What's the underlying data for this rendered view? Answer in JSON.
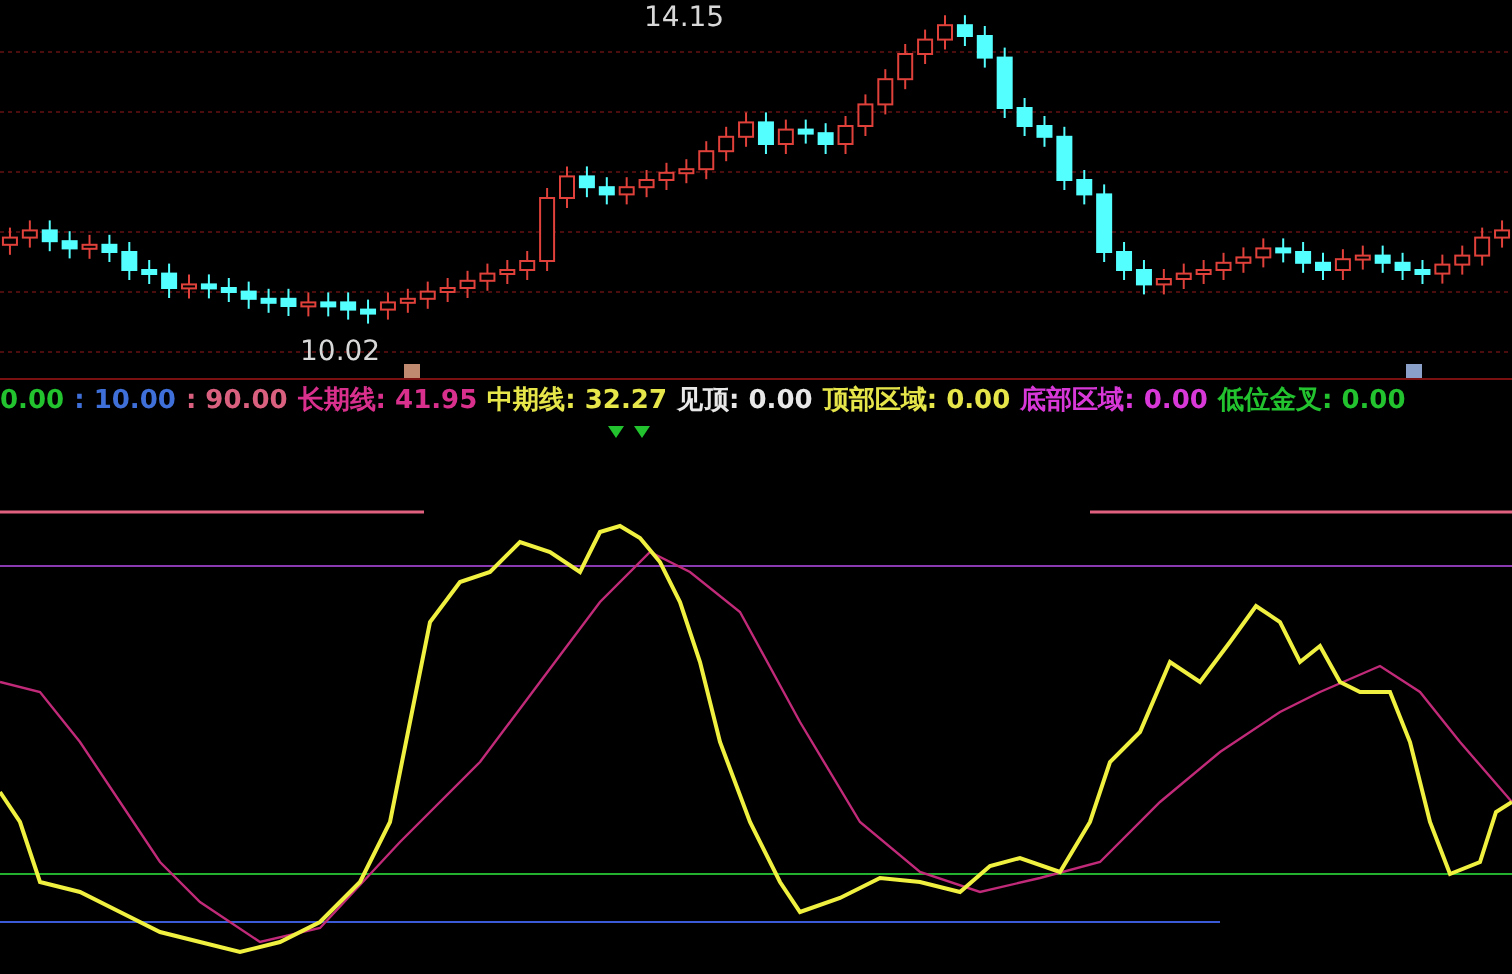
{
  "price_chart": {
    "high_label": "14.15",
    "low_label": "10.02"
  },
  "legend": [
    {
      "value": "0.00",
      "color": "#22c32e"
    },
    {
      "label": ":",
      "value": "10.00",
      "color": "#3f6fd8"
    },
    {
      "label": ":",
      "value": "90.00",
      "color": "#d9607e"
    },
    {
      "label": "长期线:",
      "value": "41.95",
      "color": "#d8308c"
    },
    {
      "label": "中期线:",
      "value": "32.27",
      "color": "#e6e64a"
    },
    {
      "label": "见顶:",
      "value": "0.00",
      "color": "#e8e8e8"
    },
    {
      "label": "顶部区域:",
      "value": "0.00",
      "color": "#e6e64a"
    },
    {
      "label": "底部区域:",
      "value": "0.00",
      "color": "#d838d8"
    },
    {
      "label": "低位金叉:",
      "value": "0.00",
      "color": "#22c32e"
    }
  ]
}
